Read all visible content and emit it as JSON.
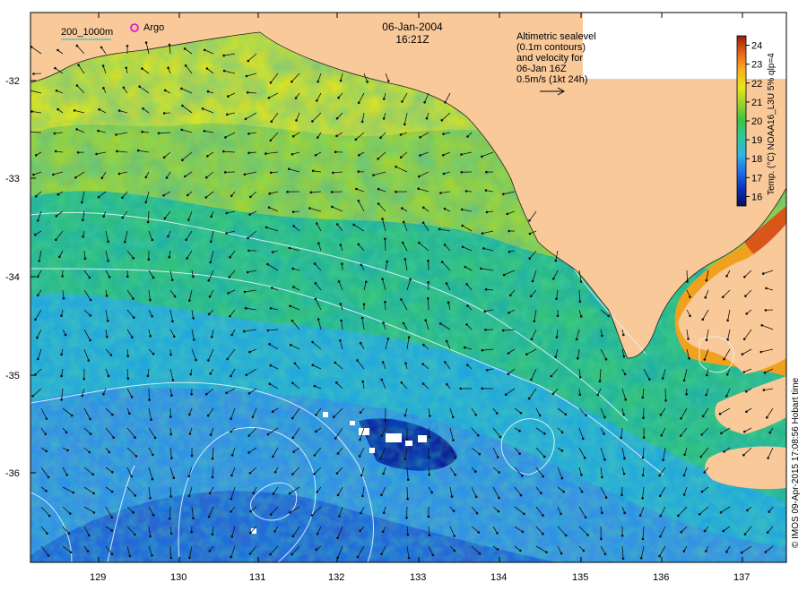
{
  "header": {
    "date": "06-Jan-2004",
    "time": "16:21Z"
  },
  "scale_legend": {
    "label": "200_1000m",
    "argo_label": "Argo",
    "argo_color": "#e000e0"
  },
  "velocity_note": {
    "lines": [
      "Altimetric sealevel",
      "(0.1m contours)",
      "and velocity for",
      "06-Jan 16Z",
      "0.5m/s (1kt 24h)"
    ]
  },
  "colorbar": {
    "title": "Temp. (°C) NOAA16_L3U 5% qlp=4",
    "ticks": [
      "24",
      "23",
      "22",
      "21",
      "20",
      "19",
      "18",
      "17",
      "16"
    ],
    "min": 15.5,
    "max": 24.5,
    "colors": [
      "#08105e",
      "#0a2fbf",
      "#1e6fe6",
      "#2fb4e6",
      "#2ec7a0",
      "#37c447",
      "#9ad12a",
      "#e8e619",
      "#f7b11c",
      "#e4641a",
      "#9a1e0b"
    ]
  },
  "axes": {
    "lat_ticks": [
      "-32",
      "-33",
      "-34",
      "-35",
      "-36"
    ],
    "lon_ticks": [
      "129",
      "130",
      "131",
      "132",
      "133",
      "134",
      "135",
      "136",
      "137"
    ]
  },
  "colors": {
    "land": "#f9c99a",
    "contour": "#e6f2ff",
    "vector": "#111111"
  },
  "credit": "© IMOS 09-Apr-2015 17:08:56 Hobart time"
}
